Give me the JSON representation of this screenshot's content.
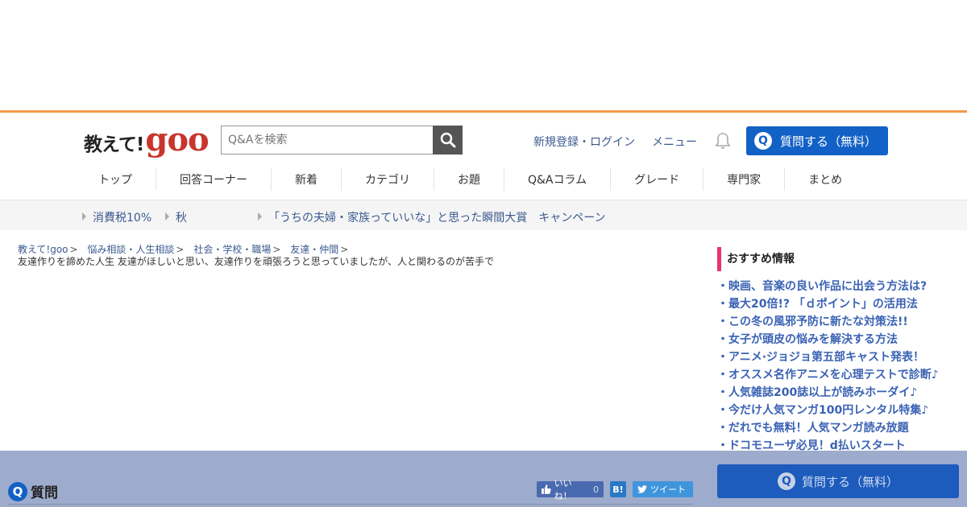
{
  "header": {
    "logo_text": "教えて!",
    "logo_goo": "goo",
    "search_placeholder": "Q&Aを検索",
    "signup_label": "新規登録・ログイン",
    "menu_label": "メニュー",
    "ask_label": "質問する（無料）",
    "ask_q": "Q"
  },
  "nav": {
    "items": [
      "トップ",
      "回答コーナー",
      "新着",
      "カテゴリ",
      "お題",
      "Q&Aコラム",
      "グレード",
      "専門家",
      "まとめ"
    ]
  },
  "subbar": {
    "items": [
      "消費税10%",
      "秋",
      "「うちの夫婦・家族っていいな」と思った瞬間大賞　キャンペーン"
    ]
  },
  "breadcrumb": {
    "items": [
      "教えて!goo",
      "悩み相談・人生相談",
      "社会・学校・職場",
      "友達・仲間"
    ],
    "separator": ">"
  },
  "question": {
    "title": "友達作りを諦めた人生 友達がほしいと思い、友達作りを頑張ろうと思っていましたが、人と関わるのが苦手で"
  },
  "recommend": {
    "heading": "おすすめ情報",
    "items": [
      "・映画、音楽の良い作品に出会う方法は?",
      "・最大20倍!? 「ｄポイント」の活用法",
      "・この冬の風邪予防に新たな対策法!!",
      "・女子が頭皮の悩みを解決する方法",
      "・アニメ·ジョジョ第五部キャスト発表！",
      "・オススメ名作アニメを心理テストで診断♪",
      "・人気雑誌200誌以上が読みホーダイ♪",
      "・今だけ人気マンガ100円レンタル特集♪",
      "・だれでも無料！人気マンガ読み放題",
      "・ドコモユーザ必見！d払いスタート"
    ]
  },
  "bottom": {
    "question_label": "質問",
    "q_mark": "Q",
    "like_label": "いいね！",
    "like_count": "0",
    "hatena_label": "B!",
    "tweet_label": "ツイート",
    "ask_label": "質問する（無料）"
  },
  "colors": {
    "accent_orange": "#f39a4c",
    "brand_red": "#c8352e",
    "primary_blue": "#1261c6",
    "recommend_pink": "#e8346a"
  }
}
